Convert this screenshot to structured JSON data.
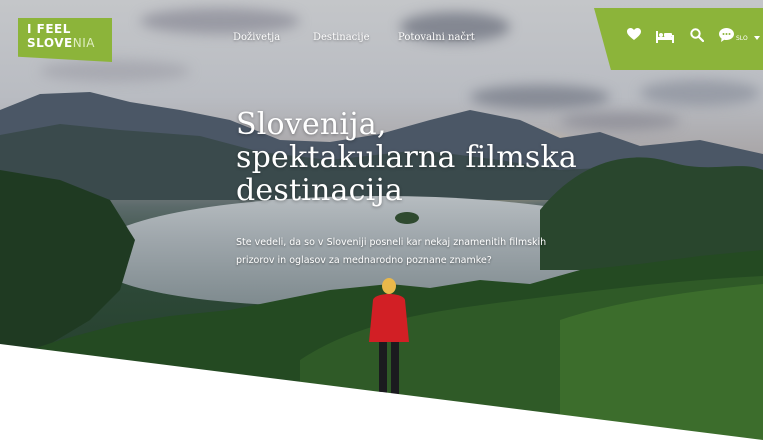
{
  "brand": {
    "logo_line1": "I FEEL",
    "logo_line2_a": "SLOVE",
    "logo_line2_b": "NIA",
    "accent_color": "#8cb43a"
  },
  "nav": {
    "items": [
      "Doživetja",
      "Destinacije",
      "Potovalni načrt"
    ]
  },
  "utility": {
    "icons": [
      "heart-icon",
      "bed-icon",
      "search-icon",
      "chat-icon"
    ],
    "language": "SLO"
  },
  "hero": {
    "headline_lines": [
      "Slovenija,",
      "spektakularna filmska",
      "destinacija"
    ],
    "lede_lines": [
      "Ste vedeli, da so v Sloveniji posneli kar nekaj znamenitih filmskih",
      "prizorov in oglasov za mednarodno poznane znamke?"
    ]
  }
}
